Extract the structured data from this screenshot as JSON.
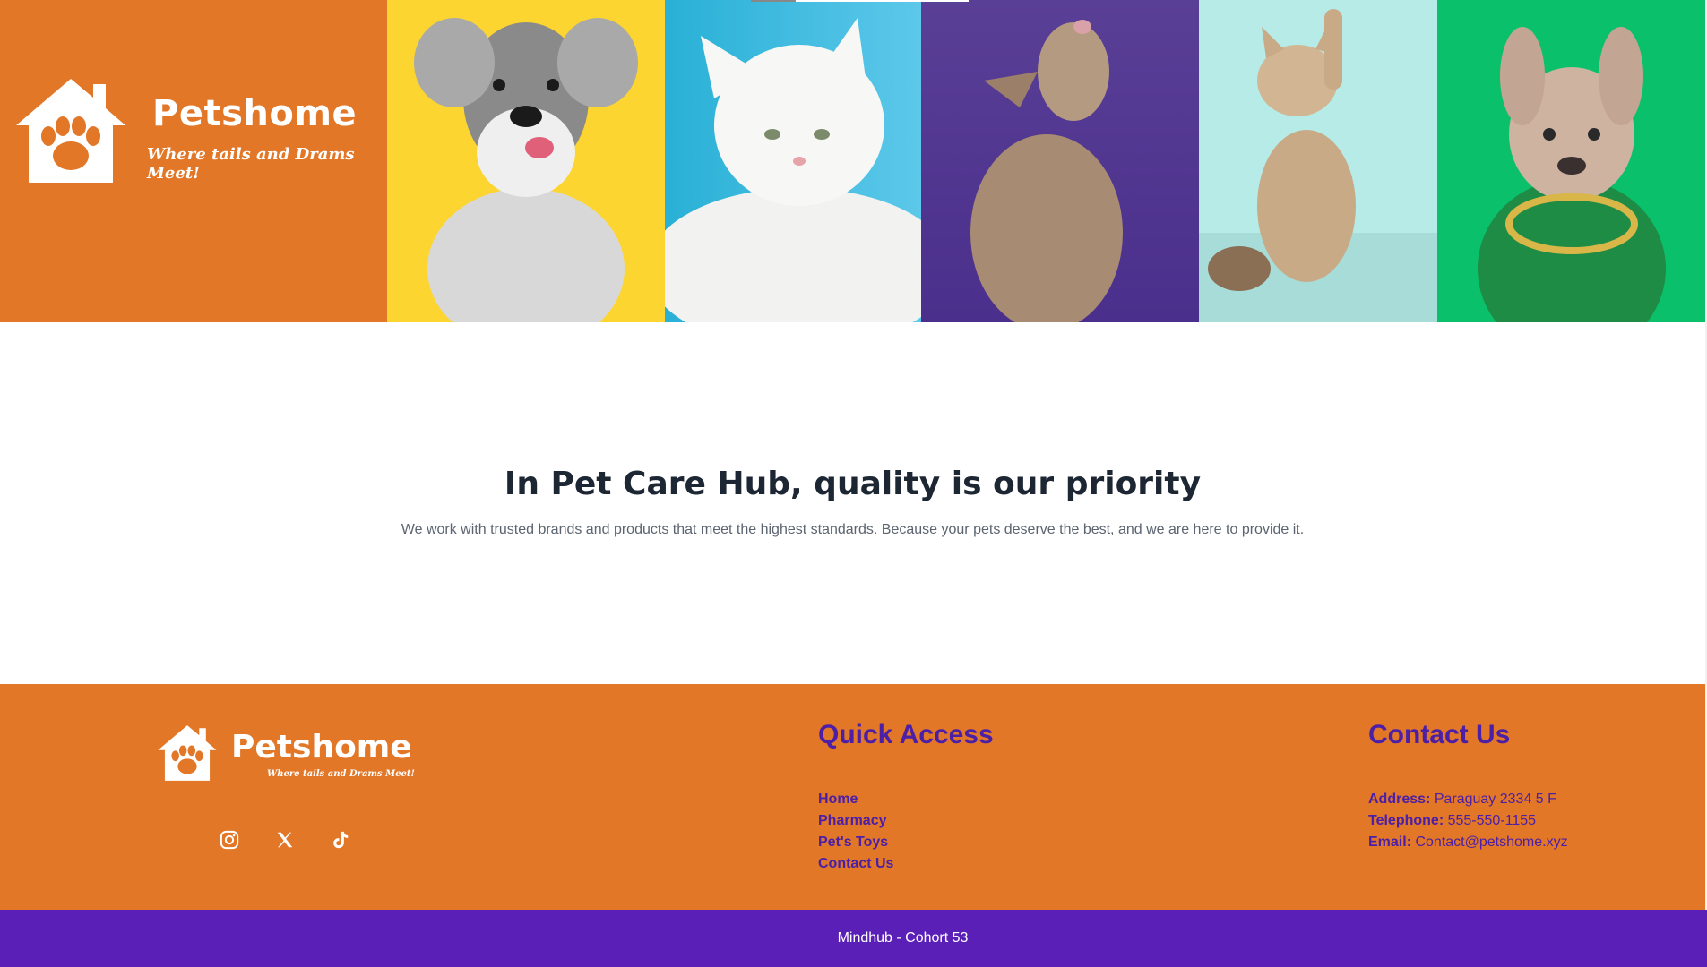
{
  "brand": {
    "name": "Petshome",
    "tagline": "Where tails and Drams Meet!"
  },
  "hero": {
    "photos": [
      "dog-photo",
      "cat-photo",
      "dog-photo",
      "cat-photo",
      "dog-photo"
    ]
  },
  "main": {
    "title": "In Pet Care Hub, quality is our priority",
    "description": "We work with trusted brands and products that meet the highest standards. Because your pets deserve the best, and we are here to provide it."
  },
  "footer": {
    "brand_name": "Petshome",
    "brand_tagline": "Where tails and Drams Meet!",
    "socials": [
      "instagram-icon",
      "x-icon",
      "tiktok-icon"
    ],
    "quick_access": {
      "title": "Quick Access",
      "links": [
        "Home",
        "Pharmacy",
        "Pet's Toys",
        "Contact Us"
      ]
    },
    "contact": {
      "title": "Contact Us",
      "address_label": "Address:",
      "address": "Paraguay 2334 5 F",
      "telephone_label": "Telephone:",
      "telephone": "555-550-1155",
      "email_label": "Email:",
      "email": "Contact@petshome.xyz"
    },
    "bottom_text": "Mindhub - Cohort 53"
  },
  "colors": {
    "orange": "#e27728",
    "purple": "#5a1fb7",
    "link_purple": "#4b1fa6",
    "yellow": "#fdd531",
    "blue": "#29b0d6",
    "violet": "#5a3f96",
    "mint": "#b7ebe8",
    "green": "#0bc06b"
  }
}
